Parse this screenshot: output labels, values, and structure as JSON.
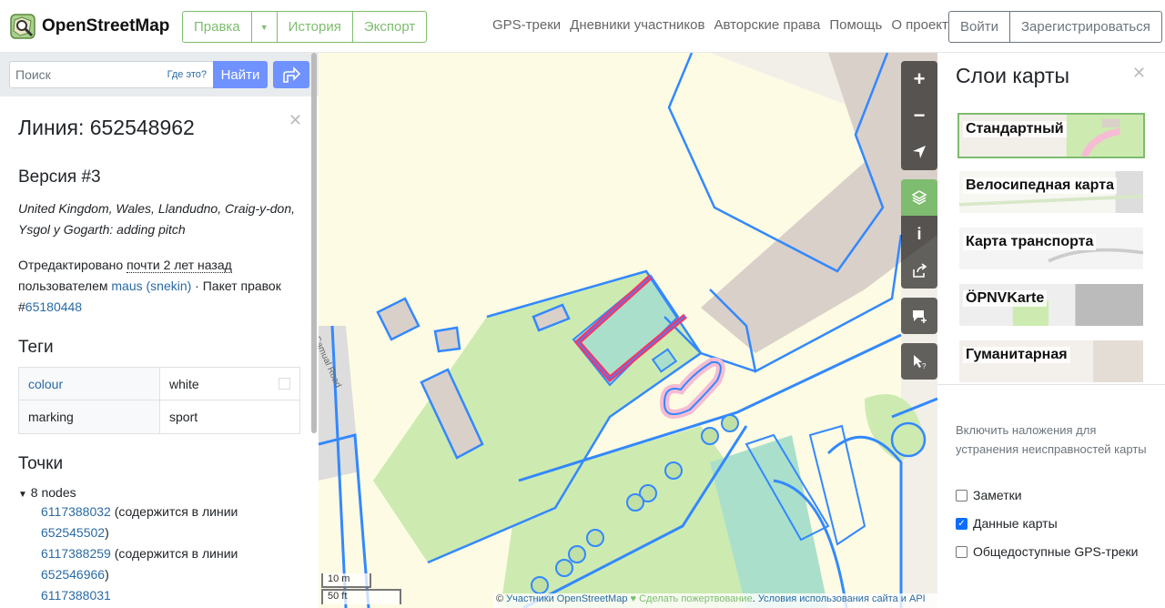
{
  "header": {
    "brand": "OpenStreetMap",
    "edit": "Правка",
    "history": "История",
    "export": "Экспорт",
    "nav": [
      "GPS-треки",
      "Дневники участников",
      "Авторские права",
      "Помощь",
      "О проекте"
    ],
    "login": "Войти",
    "signup": "Зарегистрироваться"
  },
  "search": {
    "placeholder": "Поиск",
    "where": "Где это?",
    "button": "Найти"
  },
  "way": {
    "title": "Линия: 652548962",
    "version": "Версия #3",
    "comment": "United Kingdom, Wales, Llandudno, Craig-y-don, Ysgol y Gogarth: adding pitch",
    "edited_prefix": "Отредактировано ",
    "edited_time": "почти 2 лет назад",
    "by_prefix": "пользователем ",
    "user": "maus (snekin)",
    "changeset_prefix": " · Пакет правок #",
    "changeset": "65180448",
    "tags_title": "Теги",
    "tags": [
      {
        "key": "colour",
        "value": "white"
      },
      {
        "key": "marking",
        "value": "sport"
      }
    ],
    "nodes_title": "Точки",
    "nodes_count": "8 nodes",
    "nodes": [
      {
        "id": "6117388032",
        "note": " (содержится в линии ",
        "line": "652545502",
        "close": ")"
      },
      {
        "id": "6117388259",
        "note": " (содержится в линии ",
        "line": "652546966",
        "close": ")"
      },
      {
        "id": "6117388031",
        "note": "",
        "line": "",
        "close": ""
      }
    ]
  },
  "map": {
    "road_label": "Samual Road",
    "scale_m": "10 m",
    "scale_ft": "50 ft",
    "attribution": {
      "copy": "© ",
      "contributors": "Участники OpenStreetMap",
      "heart": " ♥ ",
      "donate": "Сделать пожертвование",
      "sep": ". ",
      "terms": "Условия использования сайта и API"
    }
  },
  "layers": {
    "title": "Слои карты",
    "items": [
      "Стандартный",
      "Велосипедная карта",
      "Карта транспорта",
      "ÖPNVKarte",
      "Гуманитарная"
    ],
    "overlay_note": "Включить наложения для устранения неисправностей карты",
    "overlays": [
      {
        "label": "Заметки",
        "checked": false
      },
      {
        "label": "Данные карты",
        "checked": true
      },
      {
        "label": "Общедоступные GPS-треки",
        "checked": false
      }
    ]
  },
  "colors": {
    "brand_green": "#7ebc6f",
    "search_blue": "#7092ff",
    "link_blue": "#2a6aa3",
    "map_data_blue": "#3388ff",
    "highlight_red": "#ff3366"
  }
}
